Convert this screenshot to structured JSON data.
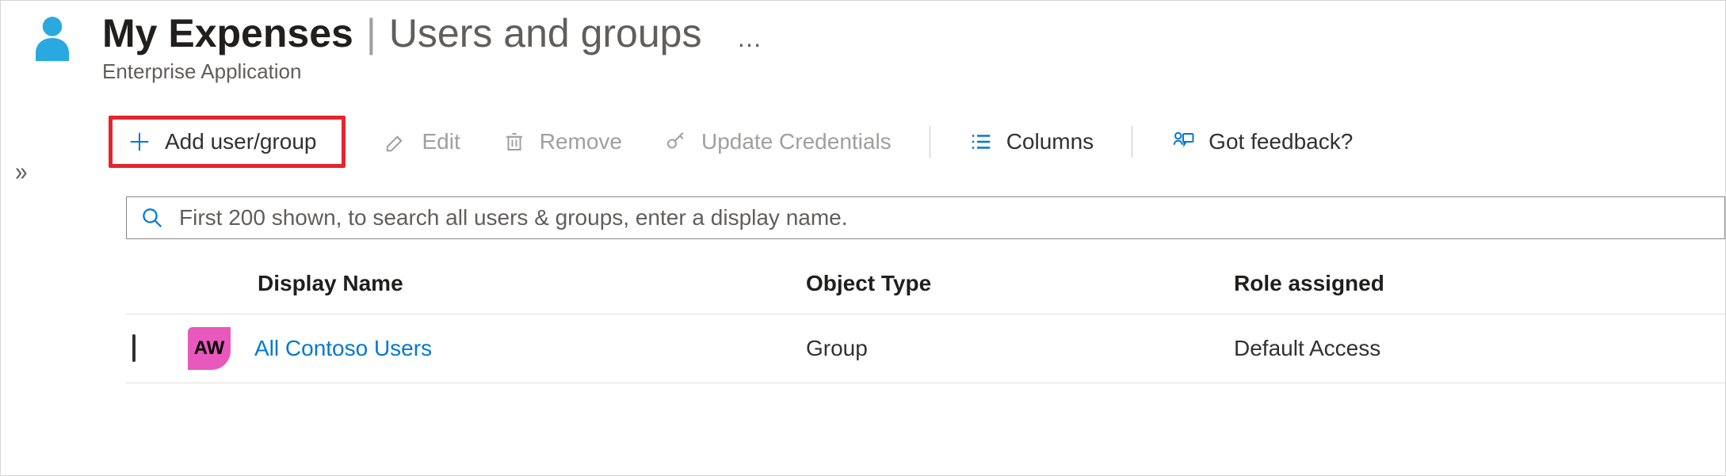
{
  "header": {
    "app_name": "My Expenses",
    "separator": "|",
    "page_name": "Users and groups",
    "subtitle": "Enterprise Application",
    "more": "…"
  },
  "toolbar": {
    "add": "Add user/group",
    "edit": "Edit",
    "remove": "Remove",
    "update": "Update Credentials",
    "columns": "Columns",
    "feedback": "Got feedback?"
  },
  "search": {
    "placeholder": "First 200 shown, to search all users & groups, enter a display name."
  },
  "table": {
    "columns": {
      "display_name": "Display Name",
      "object_type": "Object Type",
      "role": "Role assigned"
    },
    "rows": [
      {
        "initials": "AW",
        "display_name": "All Contoso Users",
        "object_type": "Group",
        "role": "Default Access"
      }
    ]
  }
}
